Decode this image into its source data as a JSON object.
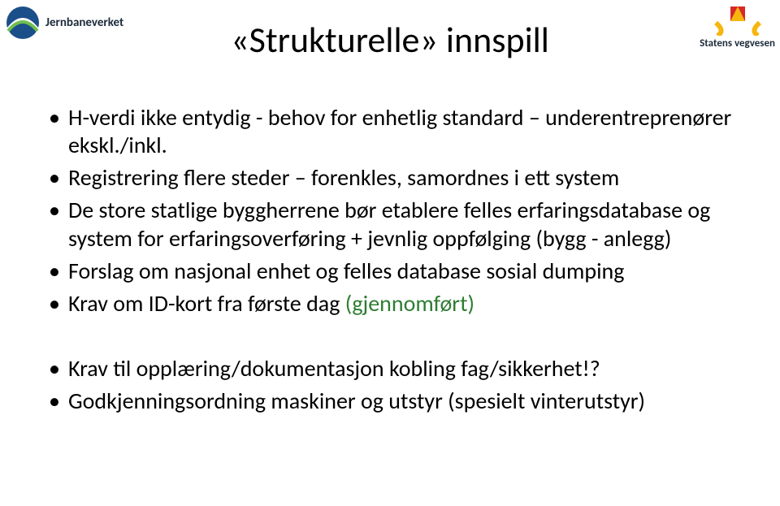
{
  "logos": {
    "left_name": "Jernbaneverket",
    "right_name": "Statens vegvesen"
  },
  "title": "«Strukturelle» innspill",
  "bullets_top": [
    "H-verdi ikke entydig - behov for enhetlig standard – underentreprenører ekskl./inkl.",
    "Registrering flere steder – forenkles, samordnes i ett system",
    "De store statlige byggherrene bør etablere felles erfaringsdatabase og system for erfaringsoverføring + jevnlig oppfølging (bygg - anlegg)",
    "Forslag om nasjonal enhet og felles database sosial dumping"
  ],
  "bullet_idkort": {
    "prefix": "Krav om ID-kort fra første dag ",
    "suffix": "(gjennomført)"
  },
  "bullets_bottom": [
    "Krav til opplæring/dokumentasjon kobling fag/sikkerhet!?",
    "Godkjenningsordning maskiner og utstyr (spesielt vinterutstyr)"
  ]
}
